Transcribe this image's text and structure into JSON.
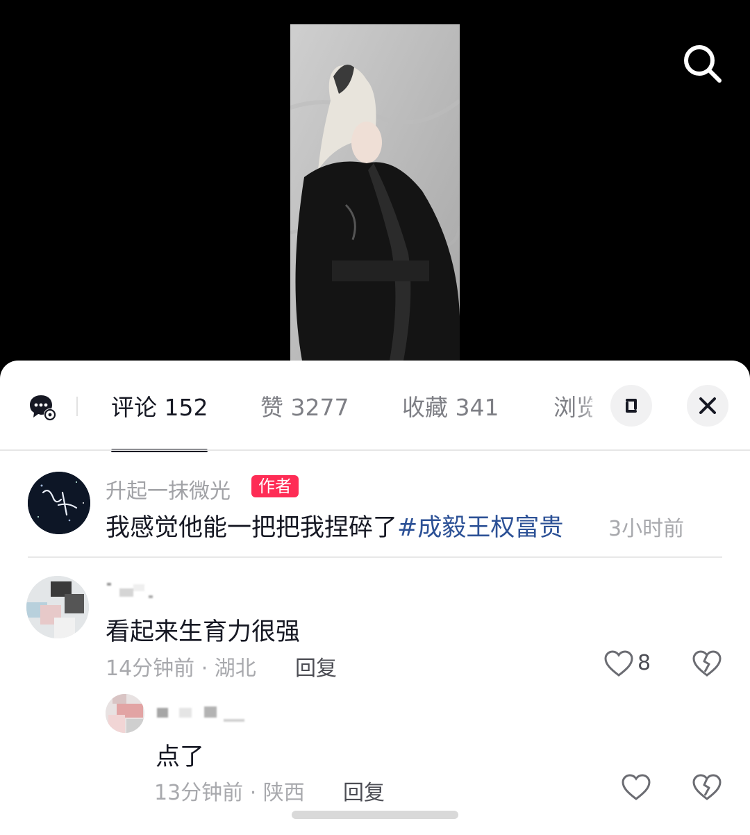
{
  "tabs": [
    {
      "label": "评论 152"
    },
    {
      "label": "赞 3277"
    },
    {
      "label": "收藏 341"
    },
    {
      "label": "浏览"
    }
  ],
  "comments": [
    {
      "author": "升起一抹微光",
      "badge": "作者",
      "text": "我感觉他能一把把我捏碎了",
      "hashtag": "#成毅王权富贵",
      "time": "3小时前"
    },
    {
      "text": "看起来生育力很强",
      "meta": "14分钟前 · 湖北",
      "reply": "回复",
      "likes": "8"
    },
    {
      "text": "点了",
      "meta": "13分钟前 · 陕西",
      "reply": "回复"
    }
  ],
  "icons": {
    "search": "search-icon",
    "chat": "comment-settings-icon",
    "expand": "expand-icon",
    "close": "close-icon",
    "like": "heart-icon",
    "dislike": "broken-heart-icon"
  },
  "colors": {
    "badge": "#fe2c55",
    "hashtag": "#2c5196"
  }
}
